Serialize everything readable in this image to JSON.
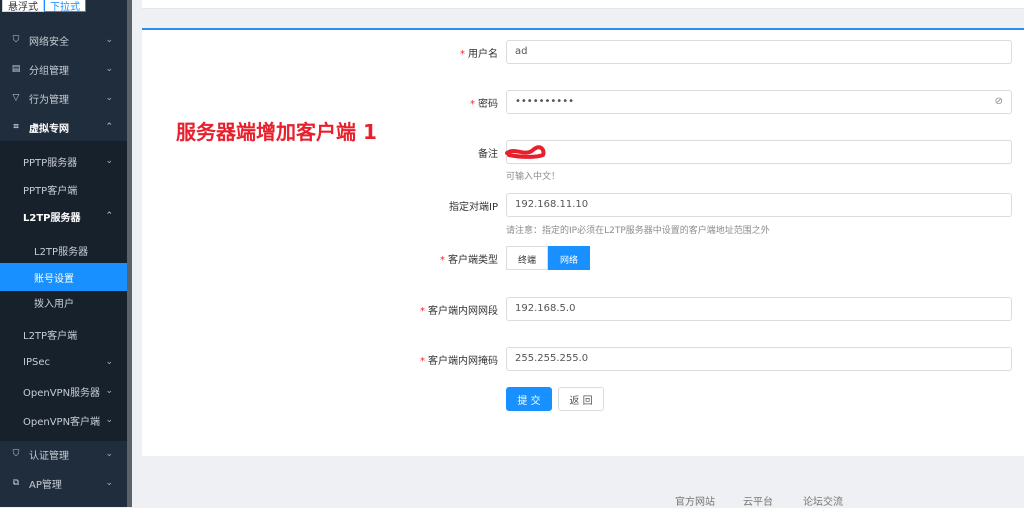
{
  "toggle": {
    "left": "悬浮式",
    "right": "下拉式"
  },
  "sidebar": {
    "items": [
      {
        "label": "网络安全",
        "icon": "shield-icon"
      },
      {
        "label": "分组管理",
        "icon": "list-icon"
      },
      {
        "label": "行为管理",
        "icon": "filter-icon"
      },
      {
        "label": "虚拟专网",
        "icon": "vpn-icon"
      },
      {
        "label": "PPTP服务器"
      },
      {
        "label": "PPTP客户端"
      },
      {
        "label": "L2TP服务器"
      },
      {
        "label": "L2TP服务器"
      },
      {
        "label": "账号设置"
      },
      {
        "label": "拨入用户"
      },
      {
        "label": "L2TP客户端"
      },
      {
        "label": "IPSec"
      },
      {
        "label": "OpenVPN服务器"
      },
      {
        "label": "OpenVPN客户端"
      },
      {
        "label": "认证管理",
        "icon": "shield-check-icon"
      },
      {
        "label": "AP管理",
        "icon": "network-icon"
      }
    ]
  },
  "form": {
    "username": {
      "label": "用户名",
      "value": "ad"
    },
    "password": {
      "label": "密码",
      "value": "••••••••••"
    },
    "remark": {
      "label": "备注",
      "hint": "可输入中文！"
    },
    "peer_ip": {
      "label": "指定对端IP",
      "value": "192.168.11.10",
      "hint": "请注意：指定的IP必须在L2TP服务器中设置的客户端地址范围之外"
    },
    "client_type": {
      "label": "客户端类型",
      "options": [
        "终端",
        "网络"
      ],
      "selected": "网络"
    },
    "lan_segment": {
      "label": "客户端内网网段",
      "value": "192.168.5.0"
    },
    "lan_mask": {
      "label": "客户端内网掩码",
      "value": "255.255.255.0"
    },
    "submit": "提 交",
    "back": "返 回"
  },
  "annotation": "服务器端增加客户端 1",
  "footer": {
    "links": [
      "官方网站",
      "云平台",
      "论坛交流"
    ]
  },
  "colors": {
    "accent": "#1890ff",
    "sidebar": "#1f2d3d",
    "annotation": "#e8202e"
  }
}
